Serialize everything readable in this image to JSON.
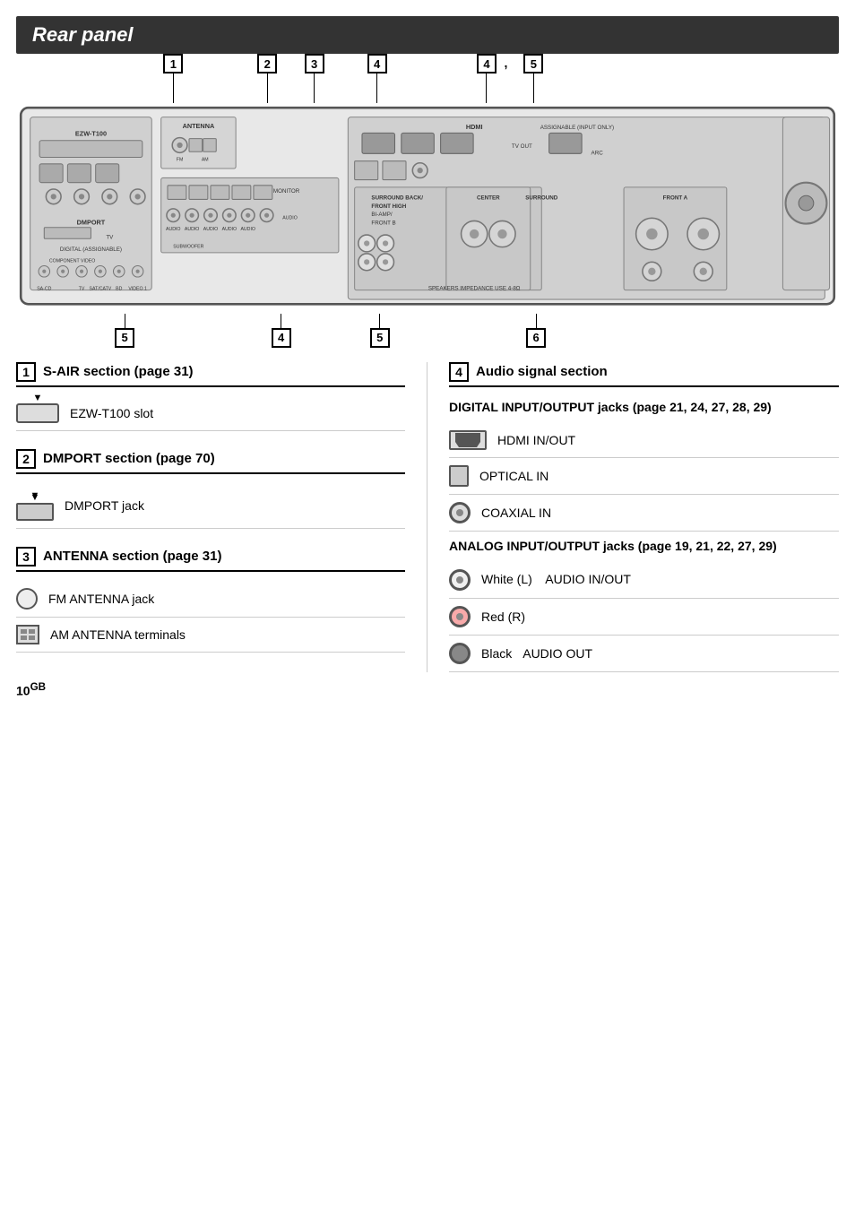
{
  "title": "Rear panel",
  "pageNumber": "10",
  "pageNumberSuffix": "GB",
  "diagram": {
    "topCallouts": [
      {
        "id": "1",
        "label": "1",
        "leftPercent": 14
      },
      {
        "id": "2",
        "label": "2",
        "leftPercent": 26
      },
      {
        "id": "3",
        "label": "3",
        "leftPercent": 32
      },
      {
        "id": "4",
        "label": "4",
        "leftPercent": 40
      },
      {
        "id": "4b",
        "label": "4",
        "leftPercent": 54
      },
      {
        "id": "5",
        "label": "5",
        "leftPercent": 58
      }
    ],
    "bottomCallouts": [
      {
        "id": "5a",
        "label": "5",
        "leftPercent": 12
      },
      {
        "id": "4c",
        "label": "4",
        "leftPercent": 31
      },
      {
        "id": "5b",
        "label": "5",
        "leftPercent": 43
      },
      {
        "id": "6",
        "label": "6",
        "leftPercent": 61
      }
    ],
    "commaPosition": {
      "leftPercent": 56,
      "text": ","
    }
  },
  "sections": {
    "left": [
      {
        "number": "1",
        "title": "S-AIR section (page 31)",
        "items": [
          {
            "iconType": "slot",
            "label": "EZW-T100 slot"
          }
        ]
      },
      {
        "number": "2",
        "title": "DMPORT section (page 70)",
        "items": [
          {
            "iconType": "dmport",
            "label": "DMPORT jack"
          }
        ]
      },
      {
        "number": "3",
        "title": "ANTENNA section (page 31)",
        "items": [
          {
            "iconType": "circle",
            "label": "FM ANTENNA jack"
          },
          {
            "iconType": "antenna-square",
            "label": "AM ANTENNA terminals"
          }
        ]
      }
    ],
    "right": [
      {
        "number": "4",
        "title": "Audio signal section",
        "subSections": [
          {
            "subTitle": "DIGITAL INPUT/OUTPUT jacks (page 21, 24, 27, 28, 29)",
            "items": [
              {
                "iconType": "hdmi",
                "label": "HDMI IN/OUT"
              },
              {
                "iconType": "optical",
                "label": "OPTICAL IN"
              },
              {
                "iconType": "rca",
                "label": "COAXIAL IN"
              }
            ]
          },
          {
            "subTitle": "ANALOG INPUT/OUTPUT jacks (page 19, 21, 22, 27, 29)",
            "items": [
              {
                "iconType": "rca",
                "color": "white",
                "label": "White (L)",
                "sublabel": "AUDIO IN/OUT"
              },
              {
                "iconType": "rca",
                "color": "red",
                "label": "Red (R)",
                "sublabel": ""
              },
              {
                "iconType": "rca",
                "color": "black",
                "label": "Black",
                "sublabel": "AUDIO OUT"
              }
            ]
          }
        ]
      }
    ]
  }
}
